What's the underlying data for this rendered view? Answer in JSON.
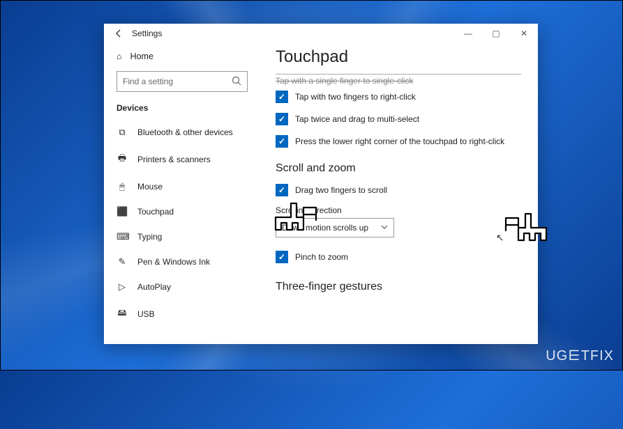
{
  "watermark": "UG⋿TFIX",
  "window": {
    "title": "Settings",
    "controls": {
      "min": "—",
      "max": "▢",
      "close": "✕"
    }
  },
  "sidebar": {
    "home_label": "Home",
    "search_placeholder": "Find a setting",
    "devices_header": "Devices",
    "items": [
      {
        "icon": "⧉",
        "label": "Bluetooth & other devices"
      },
      {
        "icon": "🖶",
        "label": "Printers & scanners"
      },
      {
        "icon": "🖱",
        "label": "Mouse"
      },
      {
        "icon": "⬛",
        "label": "Touchpad"
      },
      {
        "icon": "⌨",
        "label": "Typing"
      },
      {
        "icon": "✎",
        "label": "Pen & Windows Ink"
      },
      {
        "icon": "▷",
        "label": "AutoPlay"
      },
      {
        "icon": "🖴",
        "label": "USB"
      }
    ]
  },
  "content": {
    "page_title": "Touchpad",
    "hidden_row": "Tap with a single finger to single-click",
    "checks": [
      "Tap with two fingers to right-click",
      "Tap twice and drag to multi-select",
      "Press the lower right corner of the touchpad to right-click"
    ],
    "scroll_zoom_header": "Scroll and zoom",
    "drag_two_fingers": "Drag two fingers to scroll",
    "scrolling_direction_label": "Scrolling direction",
    "scrolling_direction_value": "Down motion scrolls up",
    "pinch_to_zoom": "Pinch to zoom",
    "three_finger_header": "Three-finger gestures"
  }
}
